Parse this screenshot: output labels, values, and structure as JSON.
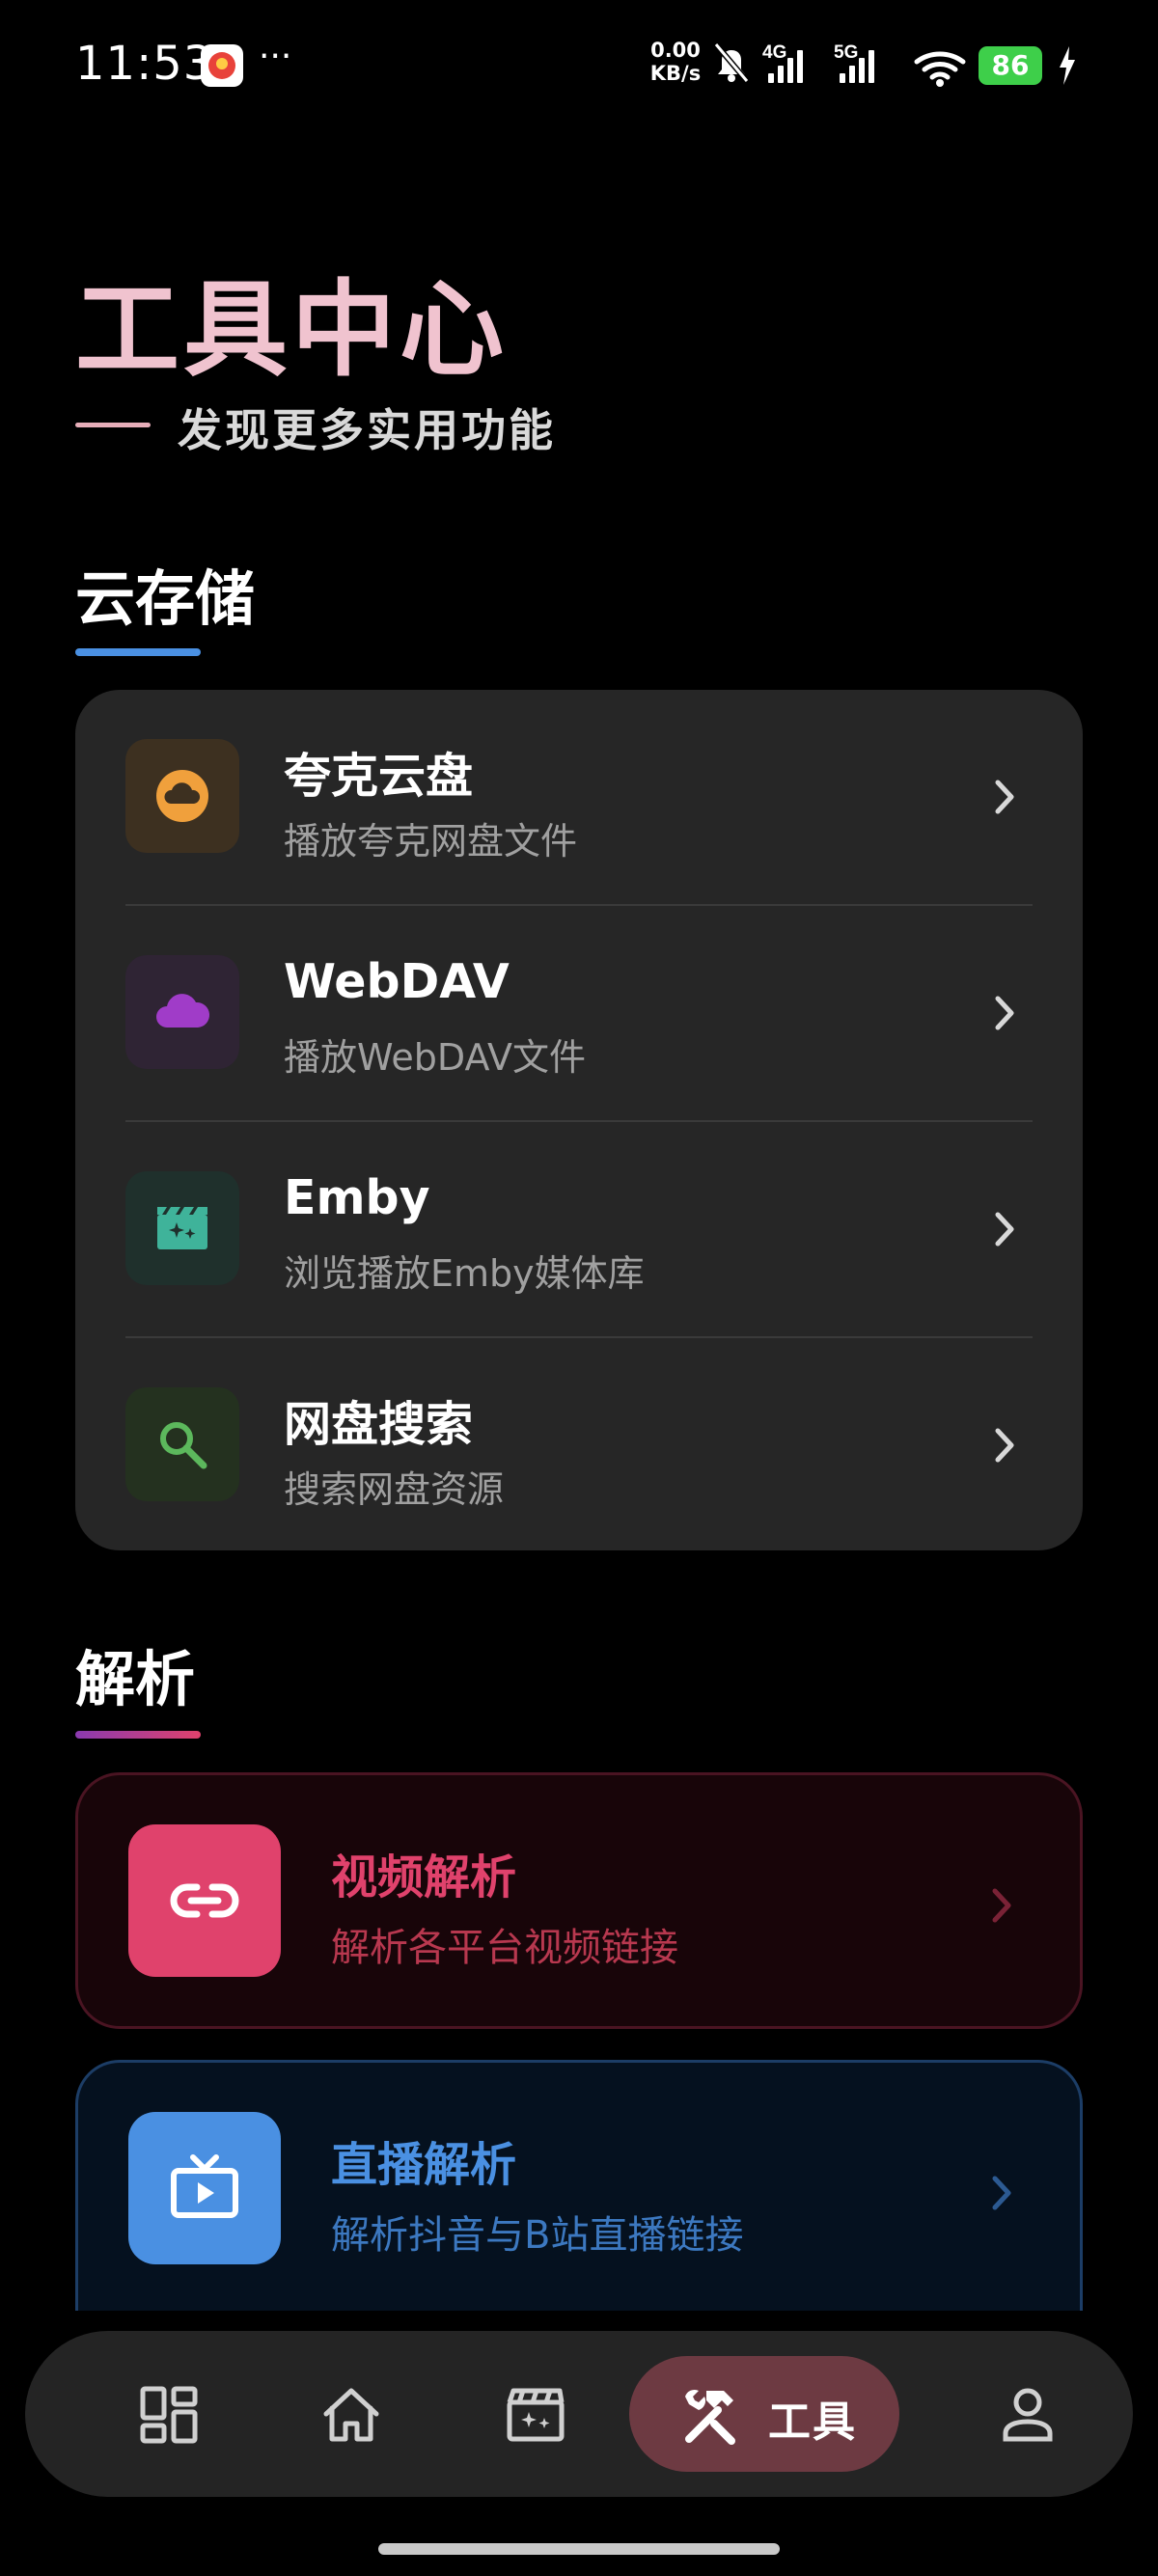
{
  "status_bar": {
    "time": "11:53",
    "more": "···",
    "net_speed_value": "0.00",
    "net_speed_unit": "KB/s",
    "signal_1_label": "4G",
    "signal_2_label": "5G",
    "battery": "86",
    "battery_color": "#3ecf4a"
  },
  "header": {
    "title": "工具中心",
    "subtitle": "发现更多实用功能",
    "title_color": "#f0c3cf"
  },
  "sections": {
    "cloud": {
      "title": "云存储",
      "accent": "#4a90e2",
      "items": [
        {
          "title": "夸克云盘",
          "desc": "播放夸克网盘文件",
          "icon": "cloud-icon",
          "icon_color": "#f0a03c",
          "icon_bg": "#3d3020"
        },
        {
          "title": "WebDAV",
          "desc": "播放WebDAV文件",
          "icon": "cloud-icon",
          "icon_color": "#a03cc8",
          "icon_bg": "#2f2434"
        },
        {
          "title": "Emby",
          "desc": "浏览播放Emby媒体库",
          "icon": "movie-icon",
          "icon_color": "#3fb39a",
          "icon_bg": "#1f302c"
        },
        {
          "title": "网盘搜索",
          "desc": "搜索网盘资源",
          "icon": "search-icon",
          "icon_color": "#5cb85c",
          "icon_bg": "#24311f"
        }
      ]
    },
    "parse": {
      "title": "解析",
      "accent": "#b03a8a",
      "items": [
        {
          "title": "视频解析",
          "desc": "解析各平台视频链接",
          "icon": "link-icon",
          "color": "#e0426c",
          "bg": "#180509",
          "border": "#4a1422"
        },
        {
          "title": "直播解析",
          "desc": "解析抖音与B站直播链接",
          "icon": "live-tv-icon",
          "color": "#4a90e2",
          "bg": "#05111f",
          "border": "#1c3d66"
        }
      ]
    }
  },
  "bottom_nav": {
    "items": [
      {
        "icon": "dashboard-icon"
      },
      {
        "icon": "home-icon"
      },
      {
        "icon": "movie-icon"
      },
      {
        "icon": "tools-icon",
        "label": "工具",
        "active": true
      },
      {
        "icon": "person-icon"
      }
    ]
  }
}
